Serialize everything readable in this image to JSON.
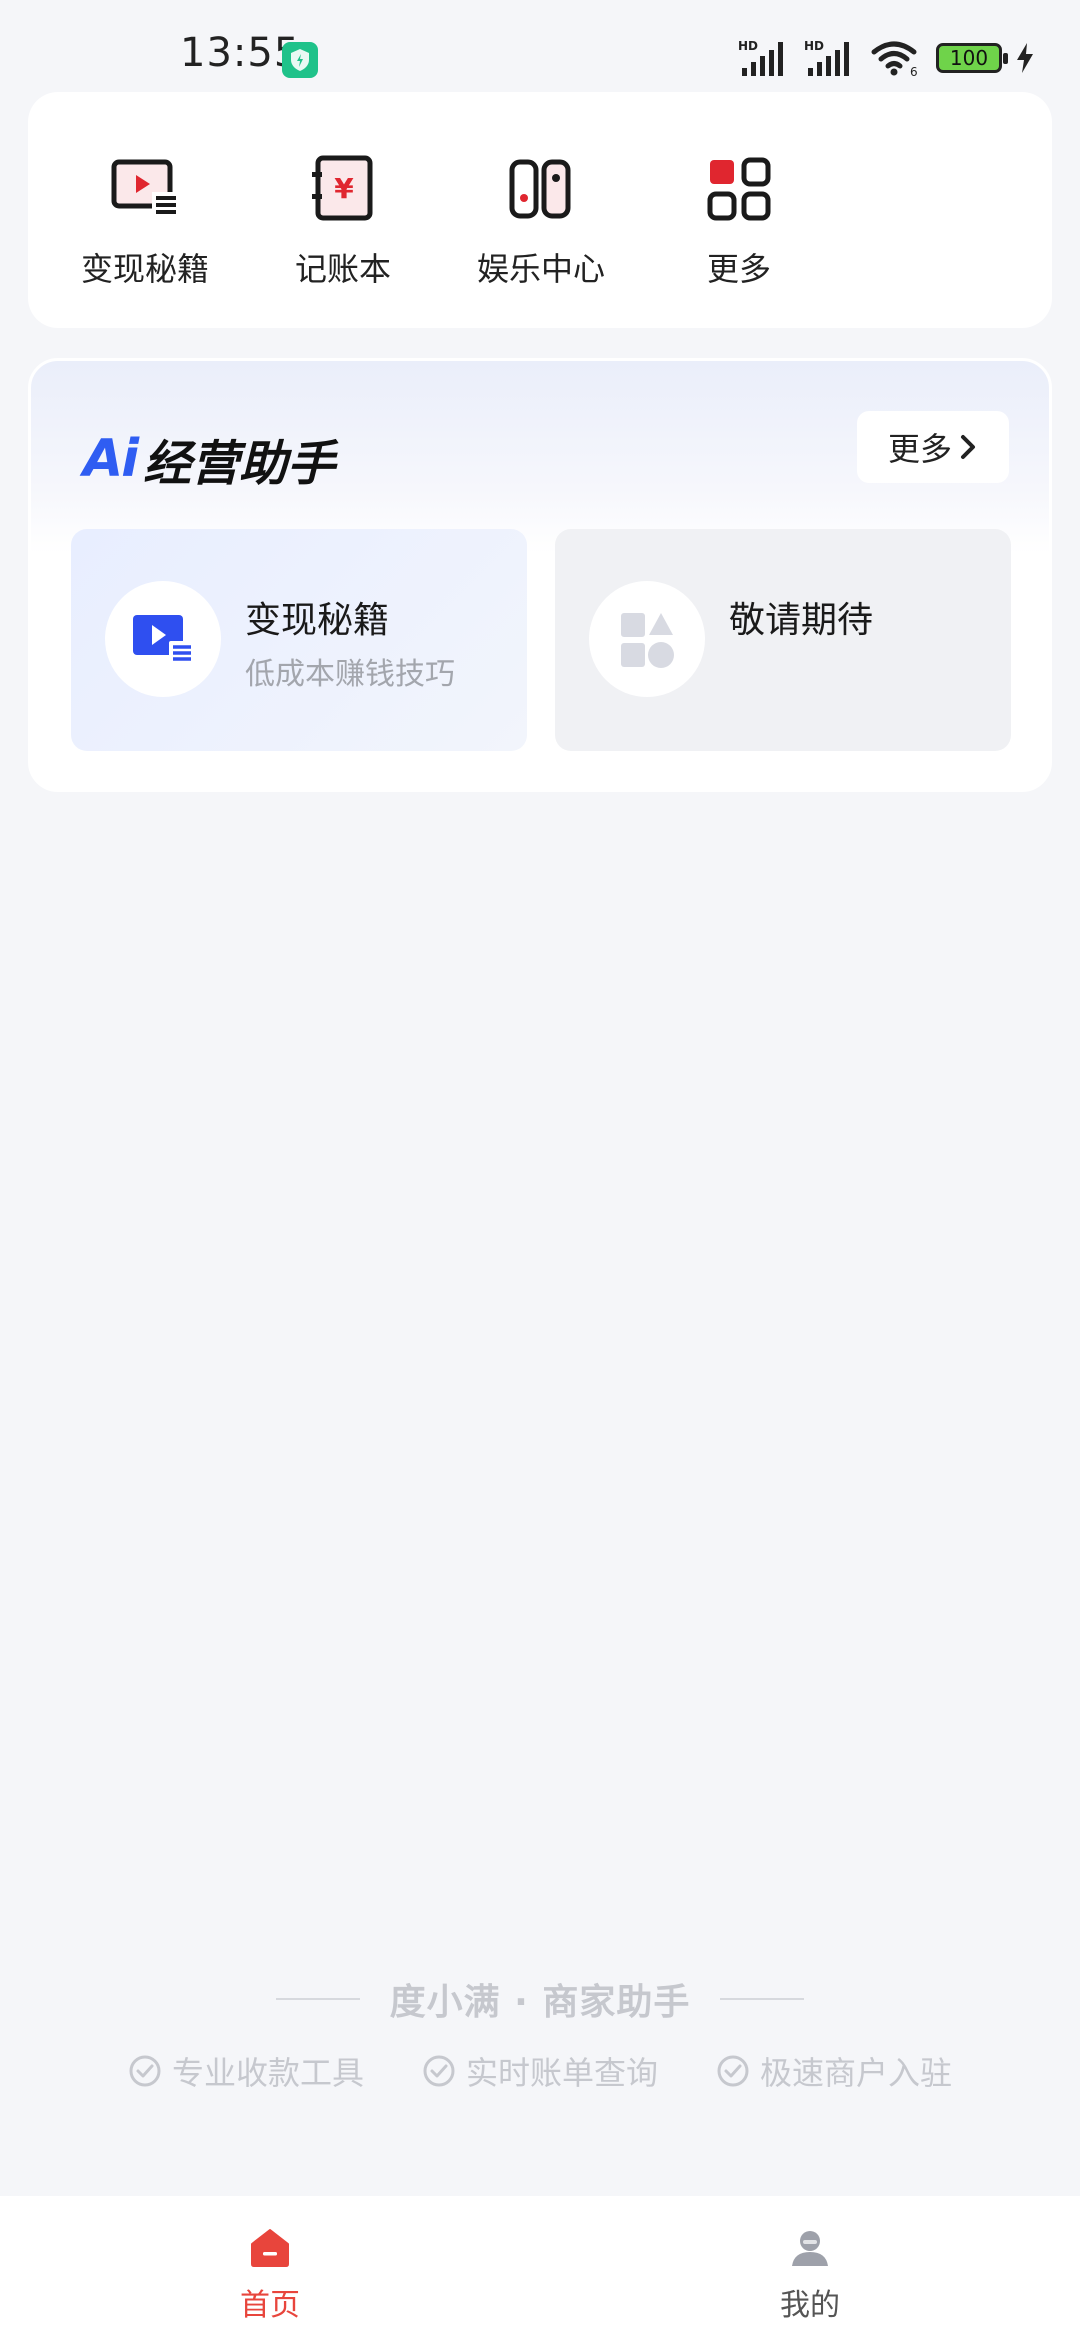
{
  "status_bar": {
    "time": "13:55",
    "battery": "100",
    "network_1": "HD",
    "network_2": "HD",
    "wifi_badge": "6"
  },
  "quick_menu": {
    "items": [
      {
        "label": "变现秘籍",
        "icon": "video-tutorial-icon"
      },
      {
        "label": "记账本",
        "icon": "ledger-icon"
      },
      {
        "label": "娱乐中心",
        "icon": "game-controller-icon"
      },
      {
        "label": "更多",
        "icon": "grid-icon"
      }
    ]
  },
  "ai_card": {
    "logo_ai": "Ai",
    "logo_text": "经营助手",
    "more_label": "更多",
    "features": [
      {
        "title": "变现秘籍",
        "subtitle": "低成本赚钱技巧",
        "icon": "video-play-icon"
      },
      {
        "title": "敬请期待",
        "subtitle": "",
        "icon": "shapes-icon"
      }
    ]
  },
  "branding": {
    "title": "度小满 · 商家助手",
    "features": [
      "专业收款工具",
      "实时账单查询",
      "极速商户入驻"
    ]
  },
  "bottom_nav": {
    "items": [
      {
        "label": "首页",
        "icon": "home-icon",
        "active": true
      },
      {
        "label": "我的",
        "icon": "profile-icon",
        "active": false
      }
    ]
  },
  "colors": {
    "accent": "#e8453c",
    "ai_blue": "#2f5df2",
    "background": "#f5f6f9",
    "muted_text": "#a3a6ad"
  }
}
